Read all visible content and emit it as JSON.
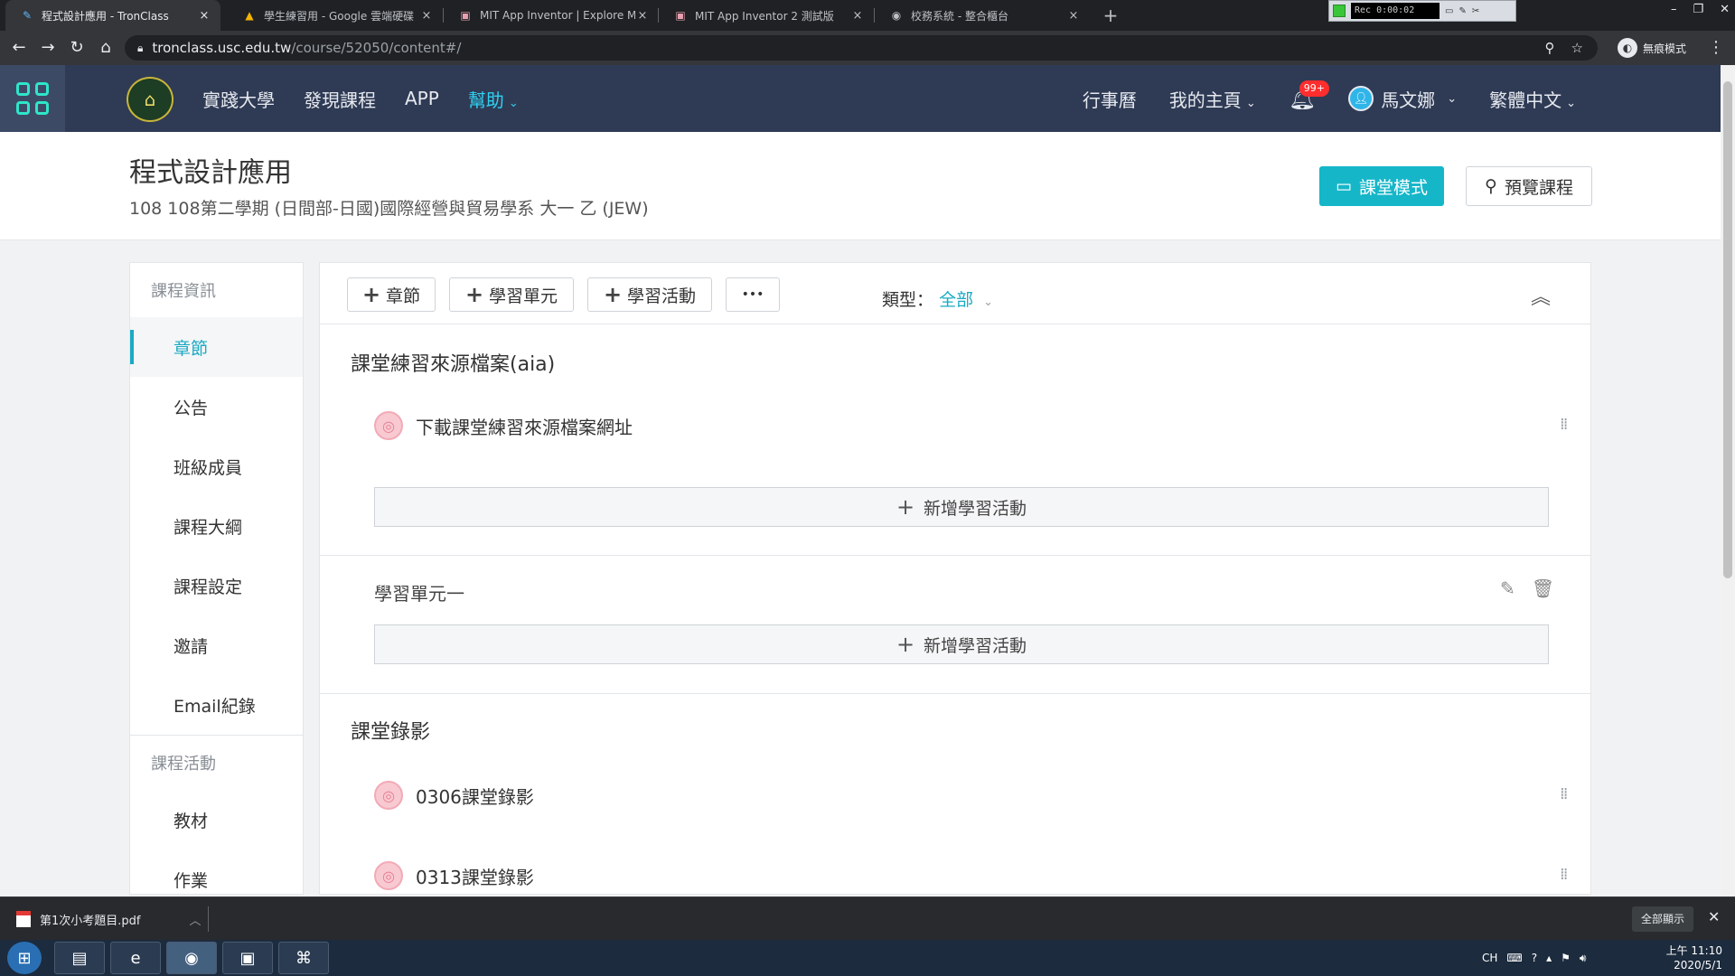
{
  "browser": {
    "tabs": [
      {
        "title": "程式設計應用 - TronClass",
        "close": "×",
        "icon": "✎",
        "active": true
      },
      {
        "title": "學生練習用 - Google 雲端硬碟",
        "close": "×",
        "icon": "▲",
        "active": false
      },
      {
        "title": "MIT App Inventor | Explore MIT",
        "close": "×",
        "icon": "▣",
        "active": false
      },
      {
        "title": "MIT App Inventor 2 測試版",
        "close": "×",
        "icon": "▣",
        "active": false
      },
      {
        "title": "校務系統 - 整合櫃台",
        "close": "×",
        "icon": "◉",
        "active": false
      }
    ],
    "new_tab": "+",
    "recorder_label": "Rec 0:00:02",
    "url_host": "tronclass.usc.edu.tw",
    "url_path": "/course/52050/content#/",
    "incognito_label": "無痕模式"
  },
  "site_nav": {
    "brand": "實踐大學",
    "links": [
      {
        "label": "實踐大學"
      },
      {
        "label": "發現課程"
      },
      {
        "label": "APP"
      }
    ],
    "help": "幫助",
    "calendar": "行事曆",
    "my_home": "我的主頁",
    "notification_badge": "99+",
    "user_name": "馬文娜",
    "language": "繁體中文",
    "accent_color": "#2fd0f0",
    "header_color": "#2f3b55"
  },
  "course": {
    "title": "程式設計應用",
    "subtitle": "108 108第二學期 (日間部-日國)國際經營與貿易學系 大一 乙 (JEW)",
    "classroom_mode": "課堂模式",
    "preview_course": "預覽課程"
  },
  "sidebar": {
    "section_info": "課程資訊",
    "items": [
      {
        "label": "章節",
        "active": true
      },
      {
        "label": "公告",
        "active": false
      },
      {
        "label": "班級成員",
        "active": false
      },
      {
        "label": "課程大綱",
        "active": false
      },
      {
        "label": "課程設定",
        "active": false
      },
      {
        "label": "邀請",
        "active": false
      },
      {
        "label": "Email紀錄",
        "active": false
      }
    ],
    "section_activities": "課程活動",
    "activity_items": [
      {
        "label": "教材"
      },
      {
        "label": "作業"
      }
    ]
  },
  "toolbar": {
    "add_chapter": "章節",
    "add_unit": "學習單元",
    "add_activity": "學習活動",
    "more": "•••",
    "type_label": "類型：",
    "type_value": "全部"
  },
  "content": {
    "chapter1_title": "課堂練習來源檔案(aia)",
    "chapter1_activity": "下載課堂練習來源檔案網址",
    "add_learning_activity": "新增學習活動",
    "unit1_title": "學習單元一",
    "chapter2_title": "課堂錄影",
    "chapter2_activities": [
      {
        "label": "0306課堂錄影"
      },
      {
        "label": "0313課堂錄影"
      }
    ]
  },
  "download_bar": {
    "file_name": "第1次小考題目.pdf",
    "show_all": "全部顯示"
  },
  "taskbar": {
    "tray_lang": "CH",
    "time": "上午 11:10",
    "date": "2020/5/1"
  }
}
